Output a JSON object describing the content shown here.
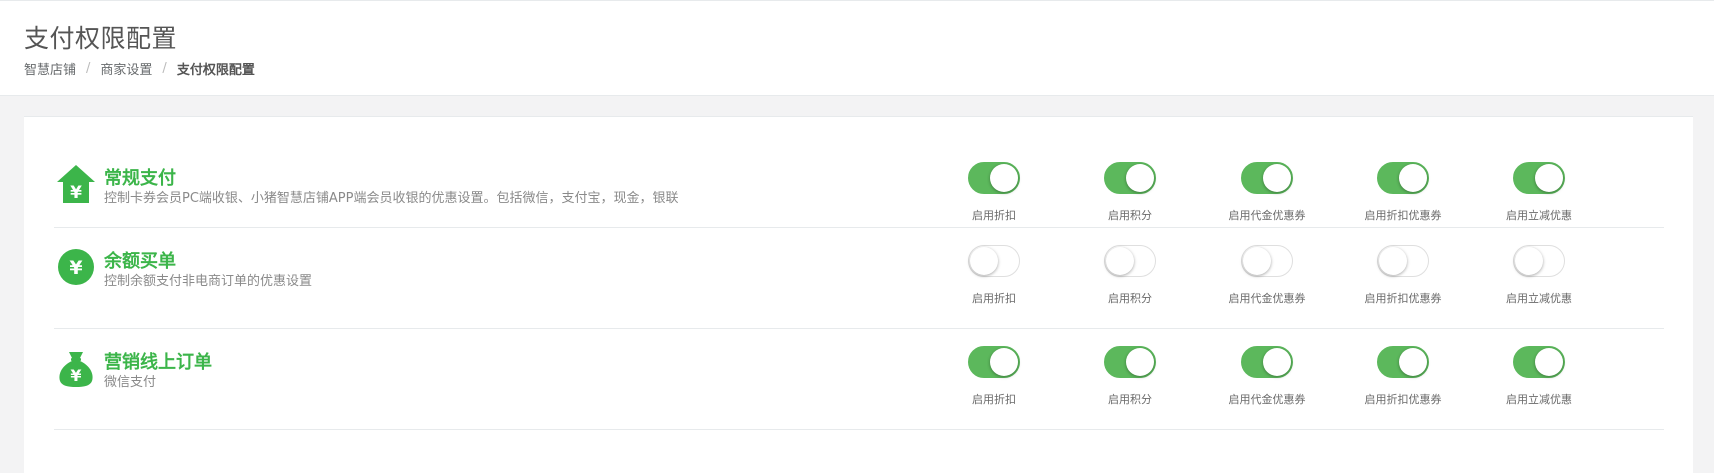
{
  "header": {
    "title": "支付权限配置",
    "breadcrumb": [
      "智慧店铺",
      "商家设置",
      "支付权限配置"
    ]
  },
  "colors": {
    "accent": "#3cb54a",
    "switch_on": "#5cb85c"
  },
  "rows": [
    {
      "icon": "home-yen-icon",
      "title": "常规支付",
      "desc": "控制卡券会员PC端收银、小猪智慧店铺APP端会员收银的优惠设置。包括微信，支付宝，现金，银联",
      "toggles": [
        {
          "label": "启用折扣",
          "on": true
        },
        {
          "label": "启用积分",
          "on": true
        },
        {
          "label": "启用代金优惠券",
          "on": true
        },
        {
          "label": "启用折扣优惠券",
          "on": true
        },
        {
          "label": "启用立减优惠",
          "on": true
        }
      ]
    },
    {
      "icon": "yen-circle-icon",
      "title": "余额买单",
      "desc": "控制余额支付非电商订单的优惠设置",
      "toggles": [
        {
          "label": "启用折扣",
          "on": false
        },
        {
          "label": "启用积分",
          "on": false
        },
        {
          "label": "启用代金优惠券",
          "on": false
        },
        {
          "label": "启用折扣优惠券",
          "on": false
        },
        {
          "label": "启用立减优惠",
          "on": false
        }
      ]
    },
    {
      "icon": "money-bag-icon",
      "title": "营销线上订单",
      "desc": "微信支付",
      "toggles": [
        {
          "label": "启用折扣",
          "on": true
        },
        {
          "label": "启用积分",
          "on": true
        },
        {
          "label": "启用代金优惠券",
          "on": true
        },
        {
          "label": "启用折扣优惠券",
          "on": true
        },
        {
          "label": "启用立减优惠",
          "on": true
        }
      ]
    }
  ],
  "icon_glyph": "¥"
}
